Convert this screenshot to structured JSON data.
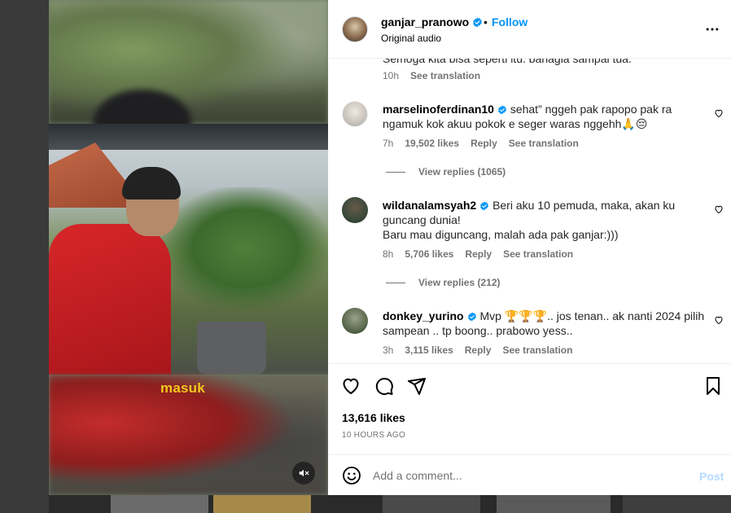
{
  "post": {
    "username": "ganjar_pranowo",
    "separator": "•",
    "follow_label": "Follow",
    "audio_label": "Original audio",
    "likes": "13,616 likes",
    "time_ago": "10 HOURS AGO"
  },
  "video": {
    "caption": "masuk"
  },
  "comments": {
    "clipped_text": "Semoga kita bisa seperti itu. bahagia sampai tua.",
    "clipped_meta": {
      "time": "10h",
      "translate": "See translation"
    },
    "items": [
      {
        "username": "marselinoferdinan10",
        "text_line1": "sehat” nggeh pak rapopo pak ra",
        "text_line2": "ngamuk kok akuu pokok e seger waras nggehh🙏😔",
        "time": "7h",
        "likes": "19,502 likes",
        "reply": "Reply",
        "translate": "See translation",
        "view_replies": "View replies (1065)"
      },
      {
        "username": "wildanalamsyah2",
        "text_line1": "Beri aku 10 pemuda, maka, akan ku",
        "text_line2": "guncang dunia!",
        "text_line3": "Baru mau diguncang, malah ada pak ganjar:)))",
        "time": "8h",
        "likes": "5,706 likes",
        "reply": "Reply",
        "translate": "See translation",
        "view_replies": "View replies (212)"
      },
      {
        "username": "donkey_yurino",
        "text_line1": "Mvp 🏆🏆🏆.. jos tenan.. ak nanti 2024 pilih",
        "text_line2": "sampean .. tp boong.. prabowo yess..",
        "time": "3h",
        "likes": "3,115 likes",
        "reply": "Reply",
        "translate": "See translation"
      }
    ]
  },
  "composer": {
    "placeholder": "Add a comment...",
    "post_label": "Post"
  },
  "colors": {
    "accent": "#0095f6",
    "verified": "#0095f6",
    "muted_text": "#737373",
    "post_disabled": "#b3dbff",
    "caption": "#f2c81d"
  },
  "icons": [
    "verified-badge-icon",
    "more-options-icon",
    "heart-icon",
    "comment-icon",
    "share-icon",
    "bookmark-icon",
    "emoji-icon",
    "mute-icon"
  ]
}
